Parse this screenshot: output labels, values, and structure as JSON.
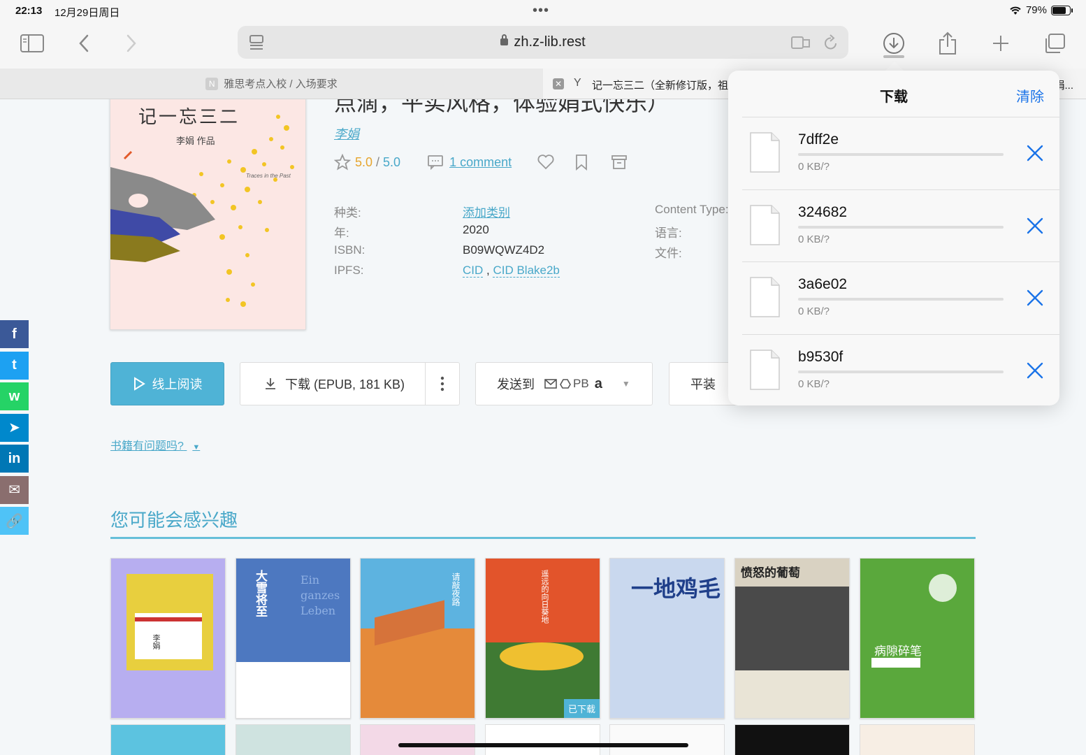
{
  "status": {
    "time": "22:13",
    "date": "12月29日周日",
    "battery": "79%",
    "battery_level": 0.79
  },
  "browser": {
    "url": "zh.z-lib.rest",
    "tabs": [
      {
        "favicon": "N",
        "title": "雅思考点入校 / 入场要求"
      },
      {
        "favicon": "Y",
        "title": "记一忘三二（全新修订版，祖",
        "title_end": "娟..."
      }
    ]
  },
  "book": {
    "cover_title": "记一忘三二",
    "cover_author": "李娟 作品",
    "cover_subtitle": "Traces in the Past",
    "title": "点滴，平实风格，体验娟式快乐）",
    "author": "李娟",
    "rating": "5.0",
    "rating_sep": " / ",
    "rating_max": "5.0",
    "comments": "1 comment",
    "props_left": [
      {
        "label": "种类:",
        "value": "添加类别"
      },
      {
        "label": "年:",
        "value": "2020"
      },
      {
        "label": "ISBN:",
        "value": "B09WQWZ4D2"
      },
      {
        "label": "IPFS:",
        "value": "CID , CID Blake2b",
        "cid": "CID",
        "comma": " , ",
        "blake": "CID Blake2b"
      }
    ],
    "props_right": [
      {
        "label": "Content Type:"
      },
      {
        "label": "语言:"
      },
      {
        "label": "文件:"
      }
    ]
  },
  "actions": {
    "read": "线上阅读",
    "download": "下载 (EPUB, 181 KB)",
    "send_to": "发送到",
    "send_pb": "PB",
    "paperback": "平装",
    "problem": "书籍有问题吗?"
  },
  "recommend": {
    "title": "您可能会感兴趣",
    "books": [
      {
        "title": "李娟",
        "color": "#b7aef0"
      },
      {
        "title": "大雪将至",
        "color": "#4d78c0"
      },
      {
        "title": "请敲夜路",
        "color": "#e58a3a"
      },
      {
        "title": "遥远的向日葵地",
        "color": "#e2542b",
        "badge": "已下载"
      },
      {
        "title": "一地鸡毛",
        "color": "#c9d8ee"
      },
      {
        "title": "愤怒的葡萄",
        "color": "#4a4a4a"
      },
      {
        "title": "病隙碎笔",
        "color": "#5aa83c"
      }
    ]
  },
  "downloads": {
    "title": "下载",
    "clear": "清除",
    "items": [
      {
        "name": "7dff2e",
        "size": "0 KB/?"
      },
      {
        "name": "324682",
        "size": "0 KB/?"
      },
      {
        "name": "3a6e02",
        "size": "0 KB/?"
      },
      {
        "name": "b9530f",
        "size": "0 KB/?"
      }
    ]
  },
  "social": [
    {
      "icon": "facebook-icon",
      "glyph": "f",
      "color": "#3b5998"
    },
    {
      "icon": "twitter-icon",
      "glyph": "t",
      "color": "#1da1f2"
    },
    {
      "icon": "whatsapp-icon",
      "glyph": "w",
      "color": "#25d366"
    },
    {
      "icon": "telegram-icon",
      "glyph": "➤",
      "color": "#0088cc"
    },
    {
      "icon": "linkedin-icon",
      "glyph": "in",
      "color": "#0077b5"
    },
    {
      "icon": "email-icon",
      "glyph": "✉",
      "color": "#8a6e6e"
    },
    {
      "icon": "link-icon",
      "glyph": "🔗",
      "color": "#4fc3f7"
    }
  ]
}
